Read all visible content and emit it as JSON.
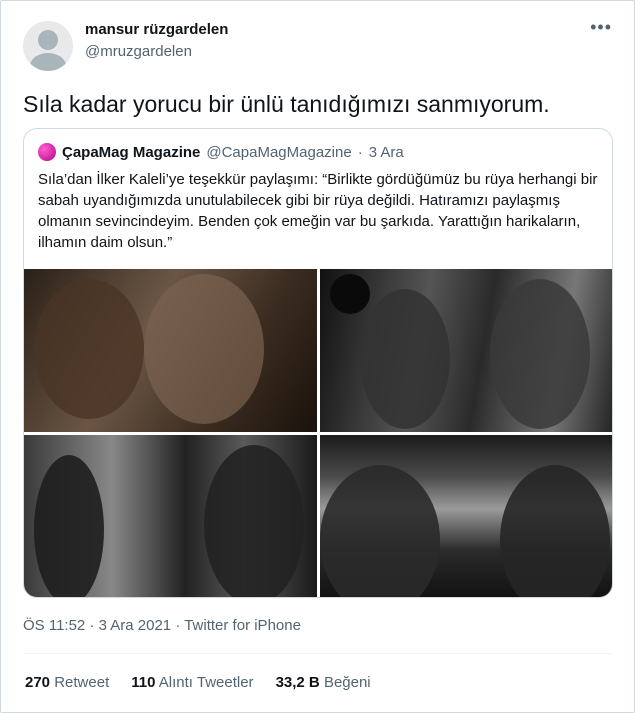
{
  "author": {
    "name": "mansur rüzgardelen",
    "handle": "@mruzgardelen"
  },
  "more_icon": "•••",
  "tweet_text": "Sıla kadar yorucu bir ünlü tanıdığımızı sanmıyorum.",
  "quote": {
    "name": "ÇapaMag Magazine",
    "handle": "@CapaMagMagazine",
    "separator": "·",
    "date": "3 Ara",
    "text": "Sıla’dan İlker Kaleli’ye teşekkür paylaşımı: “Birlikte gördüğümüz bu rüya herhangi bir sabah uyandığımızda unutulabilecek gibi bir rüya değildi. Hatıramızı paylaşmış olmanın sevincindeyim. Benden çok emeğin var bu şarkıda. Yarattığın harikaların, ilhamın daim olsun.”"
  },
  "meta": "ÖS 11:52 · 3 Ara 2021 · Twitter for iPhone",
  "stats": {
    "retweets_count": "270",
    "retweets_label": "Retweet",
    "quotes_count": "110",
    "quotes_label": "Alıntı Tweetler",
    "likes_count": "33,2 B",
    "likes_label": "Beğeni"
  },
  "colors": {
    "text": "#0f1419",
    "secondary": "#536471",
    "border": "#cfd9de"
  }
}
